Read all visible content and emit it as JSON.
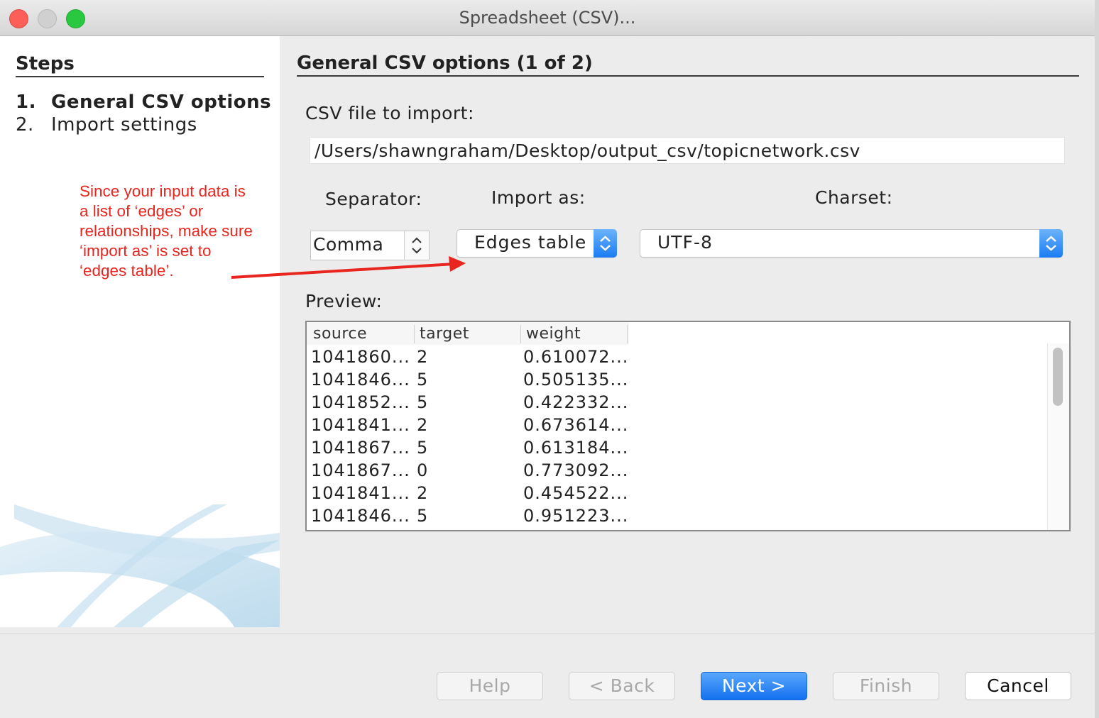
{
  "window": {
    "title": "Spreadsheet (CSV)..."
  },
  "steps": {
    "heading": "Steps",
    "items": [
      {
        "num": "1.",
        "label": "General CSV options"
      },
      {
        "num": "2.",
        "label": "Import settings"
      }
    ]
  },
  "annotation": {
    "text": "Since your input data is a list of ‘edges’ or relationships, make sure ‘import as’ is set to ‘edges table’.",
    "color": "#e8251e"
  },
  "main": {
    "heading": "General CSV options (1 of 2)",
    "file_label": "CSV file to import:",
    "file_path": "/Users/shawngraham/Desktop/output_csv/topicnetwork.csv",
    "separator_label": "Separator:",
    "separator_value": "Comma",
    "import_as_label": "Import as:",
    "import_as_value": "Edges table",
    "charset_label": "Charset:",
    "charset_value": "UTF-8",
    "preview_label": "Preview:"
  },
  "preview": {
    "columns": [
      "source",
      "target",
      "weight"
    ],
    "rows": [
      [
        "1041860...",
        "2",
        "0.610072..."
      ],
      [
        "1041846...",
        "5",
        "0.505135..."
      ],
      [
        "1041852...",
        "5",
        "0.422332..."
      ],
      [
        "1041841...",
        "2",
        "0.673614..."
      ],
      [
        "1041867...",
        "5",
        "0.613184..."
      ],
      [
        "1041867...",
        "0",
        "0.773092..."
      ],
      [
        "1041841...",
        "2",
        "0.454522..."
      ],
      [
        "1041846...",
        "5",
        "0.951223..."
      ]
    ]
  },
  "buttons": {
    "help": "Help",
    "back": "< Back",
    "next": "Next >",
    "finish": "Finish",
    "cancel": "Cancel"
  },
  "colors": {
    "accent": "#1a7cf3",
    "annotation_arrow": "#e8251e"
  }
}
